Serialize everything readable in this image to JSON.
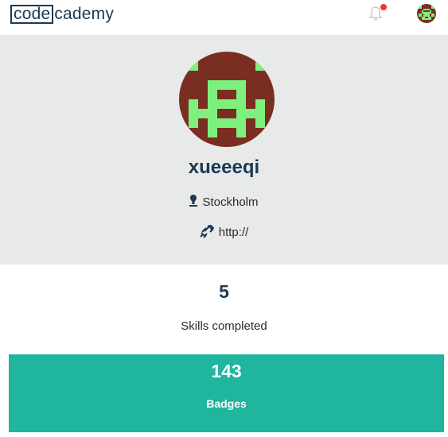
{
  "header": {
    "logo_left": "code",
    "logo_right": "cademy",
    "notification_icon": "bell-icon",
    "has_unread_notification": true,
    "avatar_icon": "user-avatar"
  },
  "profile": {
    "username": "xueeeqi",
    "location": "Stockholm",
    "location_icon": "map-pin-icon",
    "website": "http://",
    "website_icon": "link-icon",
    "avatar_colors": {
      "background": "#7a2e22",
      "foreground": "#7ef07e"
    }
  },
  "stats": {
    "skills_completed_value": "5",
    "skills_completed_label": "Skills completed",
    "badges_value": "143",
    "badges_label": "Badges"
  },
  "colors": {
    "brand": "#1c3954",
    "panel_bg": "#e8eaea",
    "badges_bg": "#1fb59f",
    "notification_dot": "#f3323b"
  }
}
